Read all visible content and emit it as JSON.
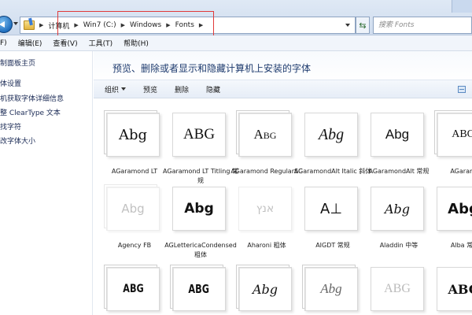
{
  "address": {
    "breadcrumbs": [
      "计算机",
      "Win7 (C:)",
      "Windows",
      "Fonts"
    ],
    "search_placeholder": "搜索 Fonts"
  },
  "menu": [
    "F)",
    "编辑(E)",
    "查看(V)",
    "工具(T)",
    "帮助(H)"
  ],
  "left_links": [
    "制面板主页",
    "体设置",
    "机获取字体详细信息",
    "整 ClearType 文本",
    "找字符",
    "改字体大小"
  ],
  "title": "预览、删除或者显示和隐藏计算机上安装的字体",
  "toolbar": {
    "organize": "组织",
    "preview": "预览",
    "delete": "删除",
    "hide": "隐藏"
  },
  "fonts_row1": [
    {
      "glyph": "Abg",
      "label": "AGaramond LT"
    },
    {
      "glyph": "ABG",
      "label": "AGaramond LT Titling 常规"
    },
    {
      "glyph": "Abg",
      "label": "AGaramond RegularSC"
    },
    {
      "glyph": "Abg",
      "label": "AGaramondAlt Italic 斜体"
    },
    {
      "glyph": "Abg",
      "label": "AGaramondAlt 常规"
    },
    {
      "glyph": "ABG",
      "label": "AGaramo"
    }
  ],
  "fonts_row2": [
    {
      "glyph": "Abg",
      "label": "Agency FB"
    },
    {
      "glyph": "Abg",
      "label": "AGLettericaCondensed 粗体"
    },
    {
      "glyph": "אנץ",
      "label": "Aharoni 粗体"
    },
    {
      "glyph": "A⊥",
      "label": "AIGDT 常规"
    },
    {
      "glyph": "Abg",
      "label": "Aladdin 中等"
    },
    {
      "glyph": "Abg",
      "label": "Alba 常规"
    }
  ],
  "fonts_row3": [
    {
      "glyph": "ABG"
    },
    {
      "glyph": "ABG"
    },
    {
      "glyph": "Abg"
    },
    {
      "glyph": "Abg"
    },
    {
      "glyph": "ABG"
    },
    {
      "glyph": "ABC"
    }
  ]
}
